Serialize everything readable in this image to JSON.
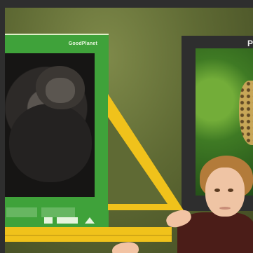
{
  "scene": {
    "left_poster_brand": "GoodPlanet",
    "right_poster_label": "P"
  },
  "icons": {
    "left_footer_icon_1": "logo-mark",
    "left_footer_icon_2": "logo-mark",
    "left_footer_icon_3": "logo-mark"
  }
}
